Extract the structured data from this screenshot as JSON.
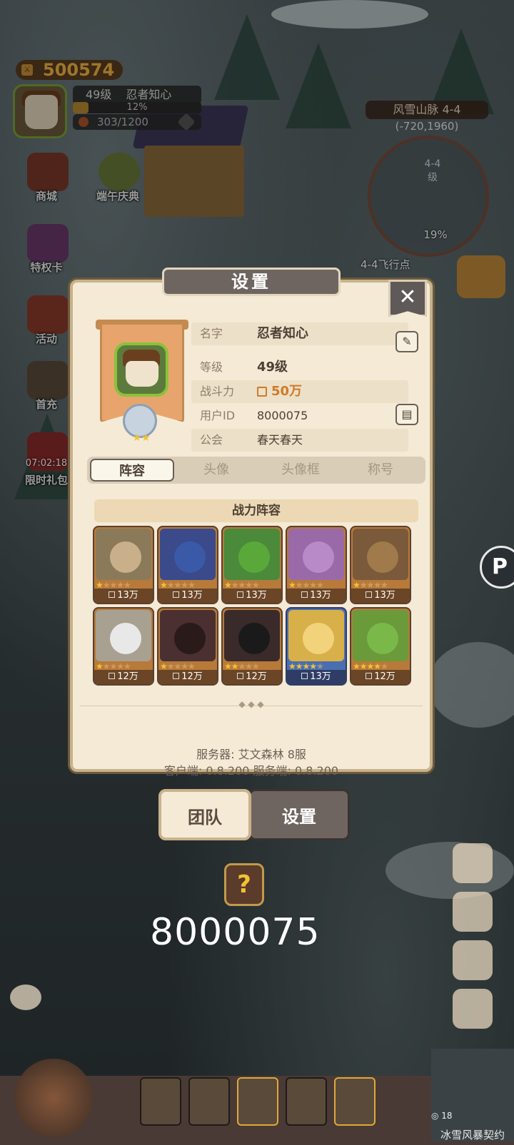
{
  "hud": {
    "gold": "500574",
    "level": "49级",
    "player_name": "忍者知心",
    "xp_percent": "12%",
    "xp_fraction": 0.12,
    "stamina": "303/1200"
  },
  "left_menu": [
    {
      "label": "商城"
    },
    {
      "label": "端午庆典"
    },
    {
      "label": "特权卡"
    },
    {
      "label": "活动"
    },
    {
      "label": "首充"
    },
    {
      "label": "限时礼包",
      "timer": "07:02:18"
    }
  ],
  "map": {
    "name": "风雪山脉 4-4",
    "coords": "(-720,1960)",
    "stage": "4-4",
    "stage_suffix": "级",
    "progress": "19%",
    "fly_point": "4-4飞行点"
  },
  "dialog": {
    "title": "设置",
    "close": "✕",
    "name_label": "名字",
    "name_value": "忍者知心",
    "level_label": "等级",
    "level_value": "49级",
    "power_label": "战斗力",
    "power_value": "50万",
    "uid_label": "用户ID",
    "uid_value": "8000075",
    "guild_label": "公会",
    "guild_value": "春天春天",
    "tabs": [
      "阵容",
      "头像",
      "头像框",
      "称号"
    ],
    "section_title": "战力阵容",
    "heroes": [
      {
        "power": "13万",
        "stars": 1,
        "frame": "orange"
      },
      {
        "power": "13万",
        "stars": 1,
        "frame": "orange"
      },
      {
        "power": "13万",
        "stars": 1,
        "frame": "orange"
      },
      {
        "power": "13万",
        "stars": 1,
        "frame": "orange"
      },
      {
        "power": "13万",
        "stars": 1,
        "frame": "orange"
      },
      {
        "power": "12万",
        "stars": 1,
        "frame": "orange"
      },
      {
        "power": "12万",
        "stars": 1,
        "frame": "orange"
      },
      {
        "power": "12万",
        "stars": 2,
        "frame": "orange"
      },
      {
        "power": "13万",
        "stars": 4,
        "frame": "blue"
      },
      {
        "power": "12万",
        "stars": 4,
        "frame": "orange"
      }
    ],
    "server_line": "服务器: 艾文森林 8服",
    "version_line": "客户端: 0.8.200   服务端: 0.8.200"
  },
  "bottom_tabs": {
    "team": "团队",
    "settings": "设置"
  },
  "overlay_id": "8000075",
  "corner_count": "18",
  "corner_title": "冰雪风暴契约",
  "colors": {
    "panel": "#f4ead6",
    "gold_text": "#f2b545",
    "power_text": "#d07a28"
  }
}
